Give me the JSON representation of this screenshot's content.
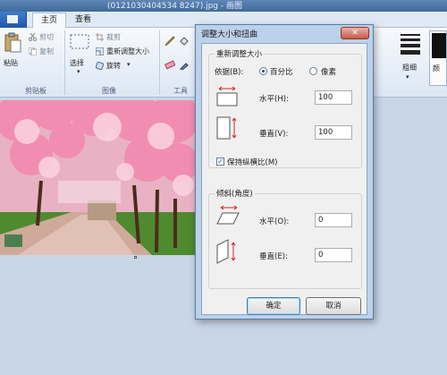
{
  "window": {
    "title": "(0121030404534 8247).jpg - 画图"
  },
  "tabs": {
    "home": "主页",
    "view": "查看"
  },
  "clipboard": {
    "group": "剪贴板",
    "paste": "粘贴",
    "cut": "剪切",
    "copy": "复制"
  },
  "image": {
    "group": "图像",
    "select": "选择",
    "crop": "裁剪",
    "resize": "重新调整大小",
    "rotate": "旋转"
  },
  "tools": {
    "group": "工具"
  },
  "right_ribbon": {
    "thickness": "粗细",
    "color": "颜"
  },
  "dialog": {
    "title": "调整大小和扭曲",
    "close": "✕",
    "resize_group": "重新调整大小",
    "basis_label": "依据(B):",
    "percent": "百分比",
    "pixels": "像素",
    "horizontal_label": "水平(H):",
    "horizontal_value": "100",
    "vertical_label": "垂直(V):",
    "vertical_value": "100",
    "keep_aspect": "保持纵横比(M)",
    "skew_group": "倾斜(角度)",
    "skew_horizontal_label": "水平(O):",
    "skew_horizontal_value": "0",
    "skew_vertical_label": "垂直(E):",
    "skew_vertical_value": "0",
    "ok": "确定",
    "cancel": "取消"
  },
  "colors": {
    "titlebar": "#3f6a9c",
    "dialog_frame": "#bcd1ea",
    "close_button": "#c9584a"
  }
}
